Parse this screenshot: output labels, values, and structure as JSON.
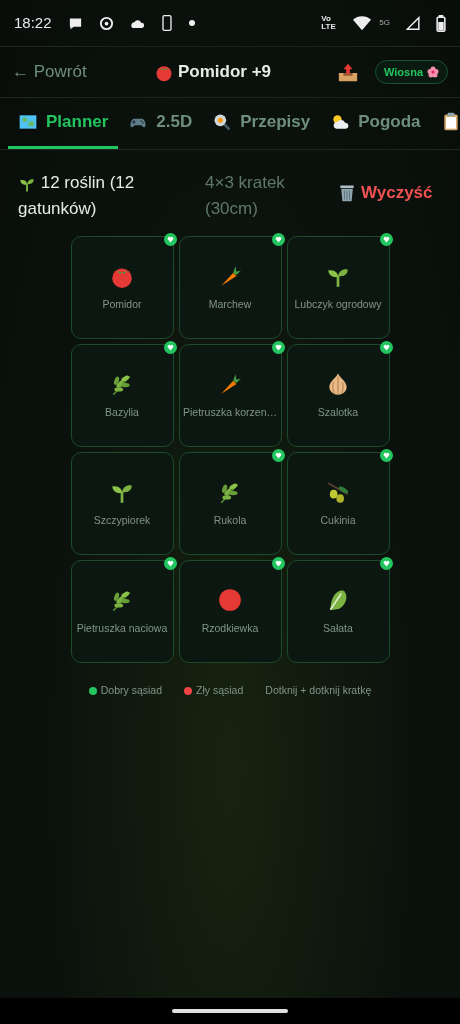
{
  "status_bar": {
    "time": "18:22",
    "network": "Vo LTE",
    "generation": "5G"
  },
  "header": {
    "back": "← Powrót",
    "title": "Pomidor +9",
    "season": "Wiosna"
  },
  "tabs": [
    {
      "label": "Planner",
      "kind": "map",
      "selected": true
    },
    {
      "label": "2.5D",
      "kind": "gamepad",
      "selected": false
    },
    {
      "label": "Przepisy",
      "kind": "pan",
      "selected": false
    },
    {
      "label": "Pogoda",
      "kind": "weather",
      "selected": false
    },
    {
      "kind": "clipboard",
      "selected": false
    }
  ],
  "summary": {
    "plants": "12 roślin (12 gatunków)",
    "grid": "4×3 kratek (30cm)",
    "clear": "Wyczyść"
  },
  "cells": [
    {
      "name": "Pomidor",
      "kind": "tomato",
      "good_neighbor": true
    },
    {
      "name": "Marchew",
      "kind": "carrot",
      "good_neighbor": true
    },
    {
      "name": "Lubczyk ogrodowy",
      "kind": "sprout",
      "good_neighbor": true
    },
    {
      "name": "Bazylia",
      "kind": "herb",
      "good_neighbor": true
    },
    {
      "name": "Pietruszka korzen…",
      "kind": "carrot",
      "good_neighbor": true
    },
    {
      "name": "Szalotka",
      "kind": "onion",
      "good_neighbor": true
    },
    {
      "name": "Szczypiorek",
      "kind": "sprout",
      "good_neighbor": false
    },
    {
      "name": "Rukola",
      "kind": "herb",
      "good_neighbor": true
    },
    {
      "name": "Cukinia",
      "kind": "olive",
      "good_neighbor": true
    },
    {
      "name": "Pietruszka naciowa",
      "kind": "herb",
      "good_neighbor": true
    },
    {
      "name": "Rzodkiewka",
      "kind": "ball",
      "good_neighbor": true
    },
    {
      "name": "Sałata",
      "kind": "lettuce",
      "good_neighbor": true
    }
  ],
  "legend": [
    {
      "label": "Dobry sąsiad",
      "color": "#22c55e"
    },
    {
      "label": "Zły sąsiad",
      "color": "#ef4444"
    },
    {
      "label": "Dotknij + dotknij kratkę"
    }
  ]
}
